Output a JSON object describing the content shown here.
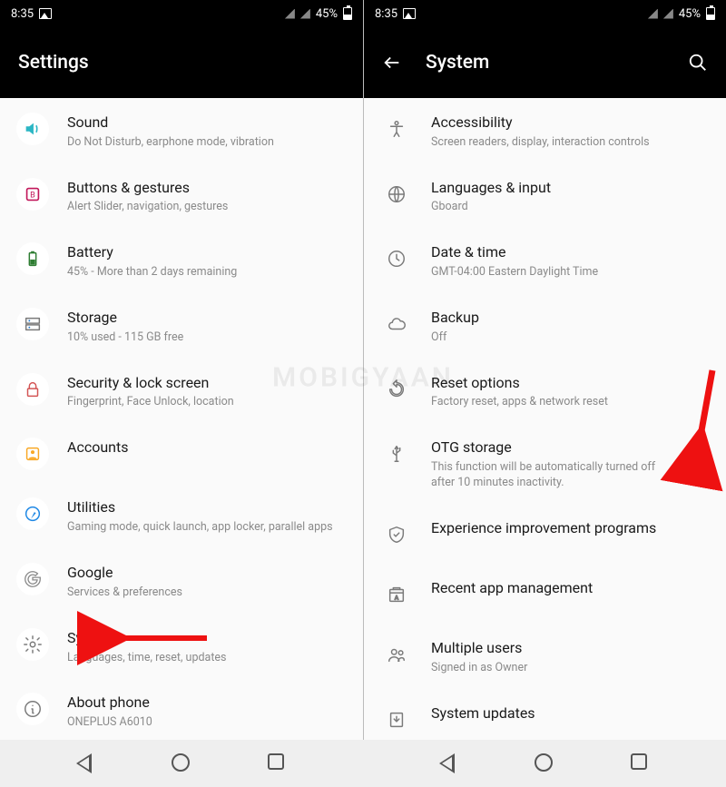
{
  "status": {
    "time": "8:35",
    "battery": "45%"
  },
  "left": {
    "title": "Settings",
    "items": [
      {
        "title": "Sound",
        "sub": "Do Not Disturb, earphone mode, vibration",
        "icon": "sound"
      },
      {
        "title": "Buttons & gestures",
        "sub": "Alert Slider, navigation, gestures",
        "icon": "buttons"
      },
      {
        "title": "Battery",
        "sub": "45% - More than 2 days remaining",
        "icon": "battery"
      },
      {
        "title": "Storage",
        "sub": "10% used - 115 GB free",
        "icon": "storage"
      },
      {
        "title": "Security & lock screen",
        "sub": "Fingerprint, Face Unlock, location",
        "icon": "lock"
      },
      {
        "title": "Accounts",
        "sub": "",
        "icon": "account"
      },
      {
        "title": "Utilities",
        "sub": "Gaming mode, quick launch, app locker, parallel apps",
        "icon": "utilities"
      },
      {
        "title": "Google",
        "sub": "Services & preferences",
        "icon": "google"
      },
      {
        "title": "System",
        "sub": "Languages, time, reset, updates",
        "icon": "gear"
      },
      {
        "title": "About phone",
        "sub": "ONEPLUS A6010",
        "icon": "info"
      }
    ]
  },
  "right": {
    "title": "System",
    "items": [
      {
        "title": "Accessibility",
        "sub": "Screen readers, display, interaction controls",
        "icon": "accessibility"
      },
      {
        "title": "Languages & input",
        "sub": "Gboard",
        "icon": "globe"
      },
      {
        "title": "Date & time",
        "sub": "GMT-04:00 Eastern Daylight Time",
        "icon": "clock"
      },
      {
        "title": "Backup",
        "sub": "Off",
        "icon": "cloud"
      },
      {
        "title": "Reset options",
        "sub": "Factory reset, apps & network reset",
        "icon": "reset"
      },
      {
        "title": "OTG storage",
        "sub": "This function will be automatically turned off after 10 minutes inactivity.",
        "icon": "usb",
        "toggle": true
      },
      {
        "title": "Experience improvement programs",
        "sub": "",
        "icon": "shield"
      },
      {
        "title": "Recent app management",
        "sub": "",
        "icon": "recent"
      },
      {
        "title": "Multiple users",
        "sub": "Signed in as Owner",
        "icon": "users"
      },
      {
        "title": "System updates",
        "sub": "",
        "icon": "update"
      }
    ]
  },
  "watermark": "MOBIGYAAN",
  "annotations": {
    "arrow_left_target": "System",
    "arrow_right_target": "OTG storage toggle"
  }
}
